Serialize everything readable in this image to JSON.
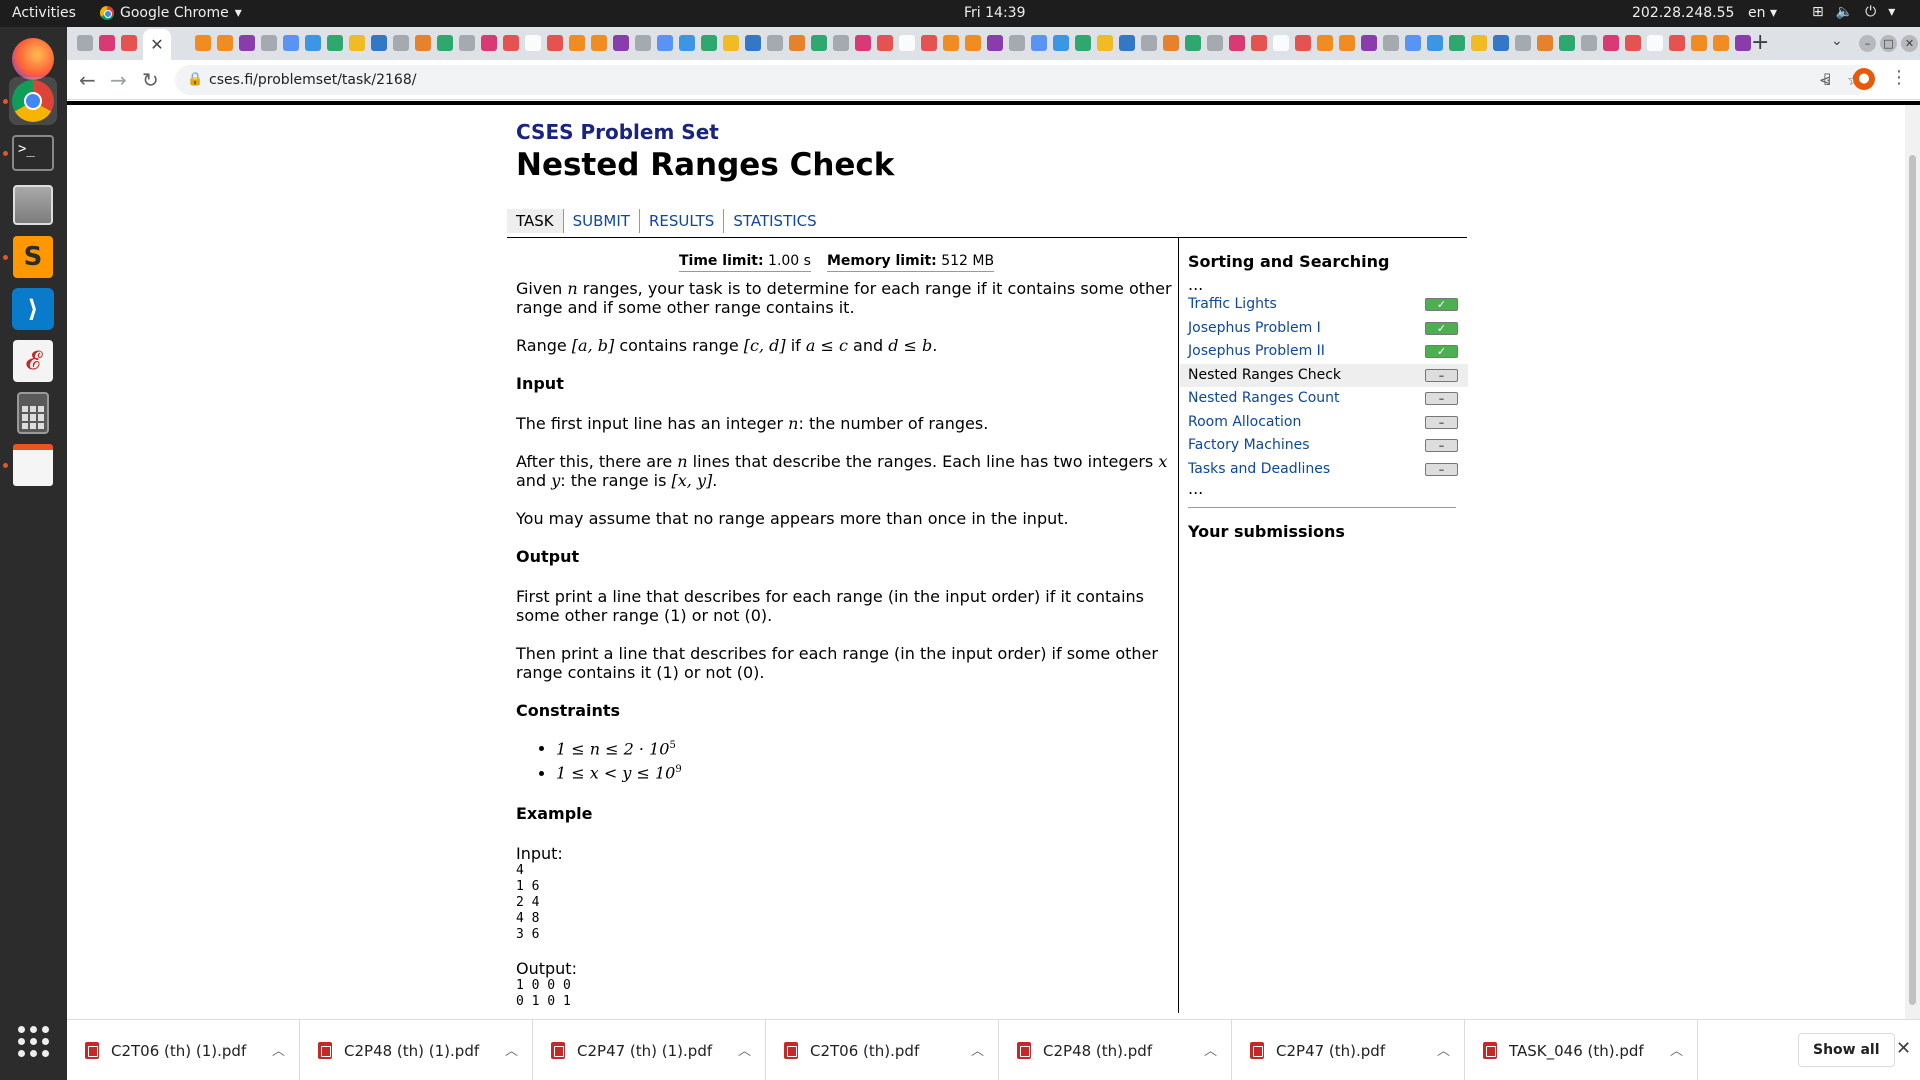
{
  "system": {
    "activities": "Activities",
    "app_name": "Google Chrome",
    "clock": "Fri 14:39",
    "ip": "202.28.248.55",
    "lang": "en"
  },
  "browser": {
    "url": "cses.fi/problemset/task/2168/",
    "active_tab_close": "✕",
    "new_tab": "+"
  },
  "page": {
    "site_title": "CSES Problem Set",
    "task_title": "Nested Ranges Check",
    "nav": [
      "TASK",
      "SUBMIT",
      "RESULTS",
      "STATISTICS"
    ],
    "time_limit_label": "Time limit:",
    "time_limit_value": "1.00 s",
    "memory_limit_label": "Memory limit:",
    "memory_limit_value": "512 MB",
    "intro": {
      "p1_a": "Given ",
      "p1_n": "n",
      "p1_b": " ranges, your task is to determine for each range if it contains some other range and if some other range contains it.",
      "p2_a": "Range ",
      "p2_ab": "[a, b]",
      "p2_b": " contains range ",
      "p2_cd": "[c, d]",
      "p2_c": " if ",
      "p2_cond1": "a ≤ c",
      "p2_d": " and ",
      "p2_cond2": "d ≤ b",
      "p2_e": "."
    },
    "input": {
      "heading": "Input",
      "p1_a": "The first input line has an integer ",
      "p1_n": "n",
      "p1_b": ": the number of ranges.",
      "p2_a": "After this, there are ",
      "p2_n": "n",
      "p2_b": " lines that describe the ranges. Each line has two integers ",
      "p2_x": "x",
      "p2_c": " and ",
      "p2_y": "y",
      "p2_d": ": the range is ",
      "p2_xy": "[x, y]",
      "p2_e": ".",
      "p3": "You may assume that no range appears more than once in the input."
    },
    "output": {
      "heading": "Output",
      "p1": "First print a line that describes for each range (in the input order) if it contains some other range (1) or not (0).",
      "p2": "Then print a line that describes for each range (in the input order) if some other range contains it (1) or not (0)."
    },
    "constraints": {
      "heading": "Constraints",
      "c1": "1 ≤ n ≤ 2 · 10",
      "c1_sup": "5",
      "c2": "1 ≤ x < y ≤ 10",
      "c2_sup": "9"
    },
    "example": {
      "heading": "Example",
      "input_label": "Input:",
      "input": "4\n1 6\n2 4\n4 8\n3 6",
      "output_label": "Output:",
      "output": "1 0 0 0\n0 1 0 1"
    }
  },
  "sidebar": {
    "heading": "Sorting and Searching",
    "ellipsis": "...",
    "items": [
      {
        "label": "Traffic Lights",
        "status": "✓"
      },
      {
        "label": "Josephus Problem I",
        "status": "✓"
      },
      {
        "label": "Josephus Problem II",
        "status": "✓"
      },
      {
        "label": "Nested Ranges Check",
        "status": "–"
      },
      {
        "label": "Nested Ranges Count",
        "status": "–"
      },
      {
        "label": "Room Allocation",
        "status": "–"
      },
      {
        "label": "Factory Machines",
        "status": "–"
      },
      {
        "label": "Tasks and Deadlines",
        "status": "–"
      }
    ],
    "submissions_heading": "Your submissions"
  },
  "downloads": {
    "items": [
      "C2T06 (th) (1).pdf",
      "C2P48 (th) (1).pdf",
      "C2P47 (th) (1).pdf",
      "C2T06 (th).pdf",
      "C2P48 (th).pdf",
      "C2P47 (th).pdf",
      "TASK_046 (th).pdf"
    ],
    "show_all": "Show all"
  },
  "colors": {
    "link": "#0d47a1",
    "site_title": "#1a237e",
    "done_green": "#4caf50",
    "ubuntu_orange": "#e95420"
  }
}
